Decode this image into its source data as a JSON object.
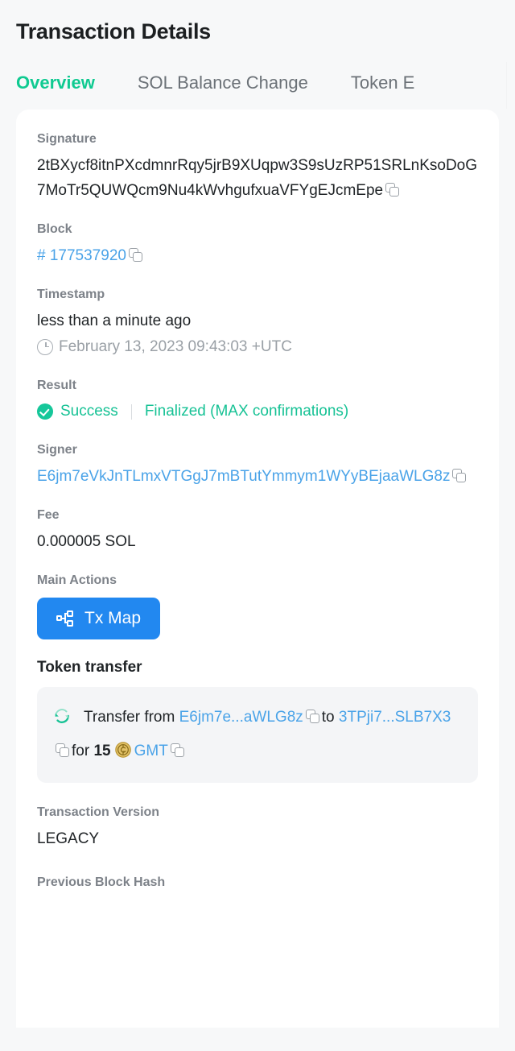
{
  "header": {
    "title": "Transaction Details"
  },
  "tabs": [
    {
      "label": "Overview",
      "active": true
    },
    {
      "label": "SOL Balance Change",
      "active": false
    },
    {
      "label": "Token E",
      "active": false
    }
  ],
  "fields": {
    "signature": {
      "label": "Signature",
      "value": "2tBXycf8itnPXcdmnrRqy5jrB9XUqpw3S9sUzRP51SRLnKsoDoG7MoTr5QUWQcm9Nu4kWvhgufxuaVFYgEJcmEpe"
    },
    "block": {
      "label": "Block",
      "value": "# 177537920"
    },
    "timestamp": {
      "label": "Timestamp",
      "relative": "less than a minute ago",
      "absolute": "February 13, 2023 09:43:03 +UTC"
    },
    "result": {
      "label": "Result",
      "status": "Success",
      "confirmation": "Finalized (MAX confirmations)"
    },
    "signer": {
      "label": "Signer",
      "value": "E6jm7eVkJnTLmxVTGgJ7mBTutYmmym1WYyBEjaaWLG8z"
    },
    "fee": {
      "label": "Fee",
      "value": "0.000005 SOL"
    },
    "main_actions": {
      "label": "Main Actions",
      "tx_map_button": "Tx Map"
    },
    "token_transfer": {
      "title": "Token transfer",
      "prefix": "Transfer from",
      "from_address": "E6jm7e...aWLG8z",
      "middle": "to",
      "to_address": "3TPji7...SLB7X3",
      "for_word": "for",
      "amount": "15",
      "token_symbol": "GMT"
    },
    "transaction_version": {
      "label": "Transaction Version",
      "value": "LEGACY"
    },
    "previous_block_hash": {
      "label": "Previous Block Hash"
    }
  },
  "colors": {
    "accent_green": "#0fca91",
    "success_green": "#16c79a",
    "link_blue": "#4aa3e8",
    "button_blue": "#2288f0",
    "page_bg": "#f7f8f9",
    "card_bg": "#ffffff",
    "coin_gold": "#d4a843"
  },
  "icons": {
    "copy": "copy-icon",
    "clock": "clock-icon",
    "check": "check-circle-icon",
    "tx_map": "sitemap-icon",
    "swap": "swap-arrows-icon",
    "coin": "gmt-coin-icon"
  }
}
